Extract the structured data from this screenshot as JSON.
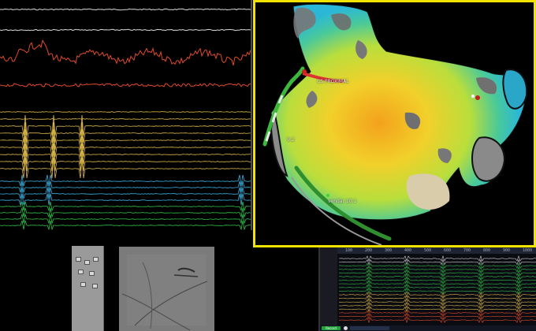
{
  "map": {
    "labels": [
      "CS PROXIMAL",
      "9.2",
      "vendar 10.1"
    ],
    "border_color": "#f2e200"
  },
  "electrograms": {
    "colors": [
      "#d8d8d8",
      "#d8d8d8",
      "#e04a2a",
      "#e04a2a",
      "#d9b64a",
      "#d9b64a",
      "#d9b64a",
      "#d9b64a",
      "#d9b64a",
      "#d9b64a",
      "#d9b64a",
      "#d9b64a",
      "#d9b64a",
      "#3ab0e0",
      "#3ab0e0",
      "#3ab0e0",
      "#3ab0e0",
      "#2fbf4a",
      "#2fbf4a",
      "#2fbf4a",
      "#2fbf4a"
    ]
  },
  "recording": {
    "ruler_ticks": [
      "100",
      "200",
      "300",
      "400",
      "500",
      "600",
      "700",
      "800",
      "900",
      "1000"
    ],
    "record_label": "Record",
    "gear_icon": "gear-icon"
  }
}
